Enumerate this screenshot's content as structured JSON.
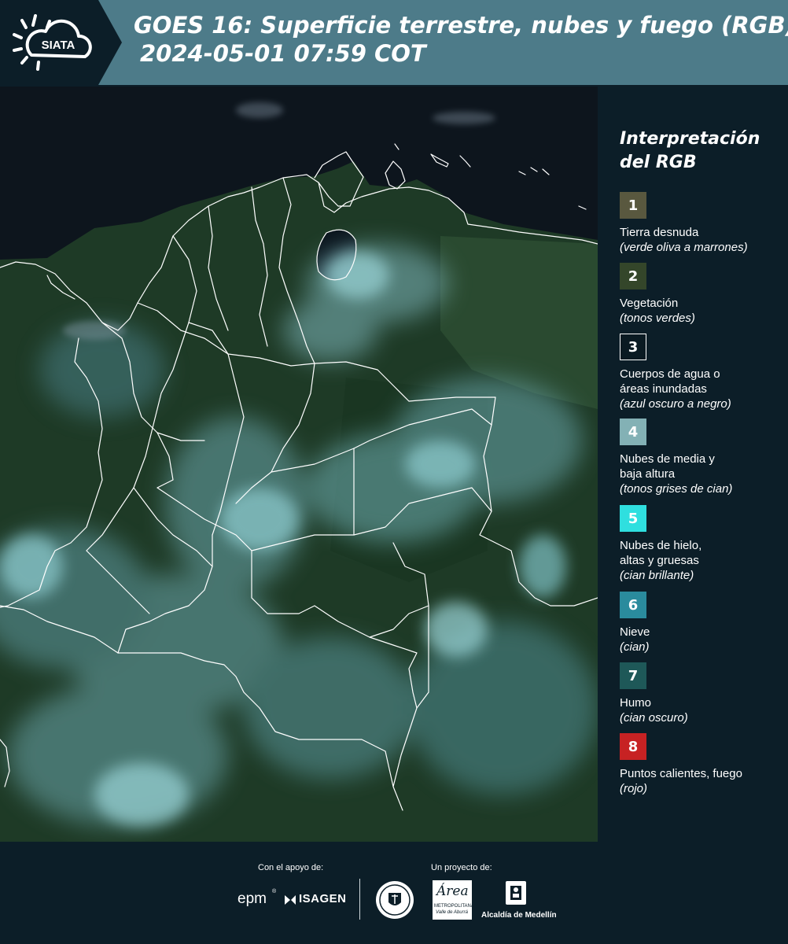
{
  "header": {
    "brand": "SIATA",
    "title_line1": "GOES 16: Superficie terrestre, nubes y fuego (RGB)",
    "title_line2": "2024-05-01 07:59 COT"
  },
  "legend": {
    "title_line1": "Interpretación",
    "title_line2": "del RGB",
    "items": [
      {
        "n": "1",
        "color": "#59583f",
        "lines": [
          "Tierra desnuda"
        ],
        "sub": "(verde oliva a marrones)"
      },
      {
        "n": "2",
        "color": "#34462a",
        "lines": [
          "Vegetación"
        ],
        "sub": "(tonos verdes)"
      },
      {
        "n": "3",
        "color": "#0a1a22",
        "lines": [
          "Cuerpos de agua o",
          "áreas inundadas"
        ],
        "sub": "(azul oscuro a negro)"
      },
      {
        "n": "4",
        "color": "#83b1b5",
        "lines": [
          "Nubes de media y",
          "baja altura"
        ],
        "sub": "(tonos grises de cian)"
      },
      {
        "n": "5",
        "color": "#2fdfdf",
        "lines": [
          "Nubes de hielo,",
          "altas y gruesas"
        ],
        "sub": "(cian brillante)"
      },
      {
        "n": "6",
        "color": "#2a8b9d",
        "lines": [
          "Nieve"
        ],
        "sub": "(cian)"
      },
      {
        "n": "7",
        "color": "#1e5858",
        "lines": [
          "Humo"
        ],
        "sub": "(cian oscuro)"
      },
      {
        "n": "8",
        "color": "#c72223",
        "lines": [
          "Puntos calientes, fuego"
        ],
        "sub": "(rojo)"
      }
    ]
  },
  "footer": {
    "support_label": "Con el apoyo de:",
    "project_label": "Un proyecto de:",
    "epm": "epm",
    "isagen": "ISAGEN",
    "area_script": "Área",
    "area_sub1": "METROPOLITANA",
    "area_sub2": "Valle de Aburrá",
    "alcaldia": "Alcaldía de Medellín"
  }
}
